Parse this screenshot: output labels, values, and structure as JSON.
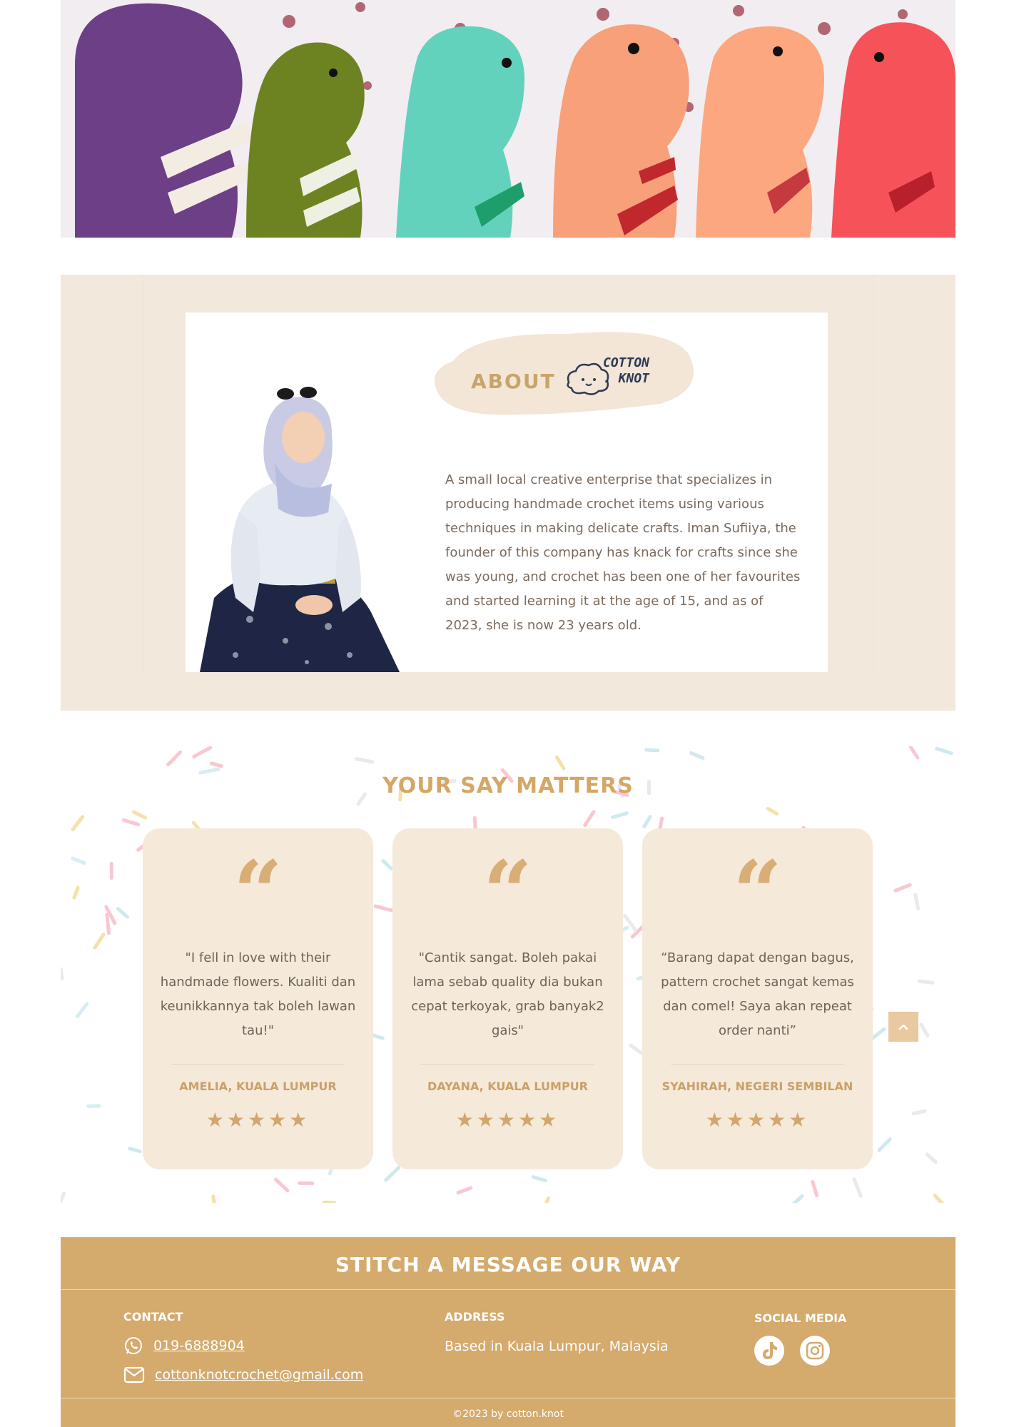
{
  "about": {
    "title": "ABOUT",
    "logo_line1": "COTTON",
    "logo_line2": ". KNOT",
    "paragraph": "A small local creative enterprise that specializes in producing handmade crochet items using various techniques in making delicate crafts. Iman Sufiiya, the founder of this company has knack for crafts since she was young, and crochet has been one of her favourites and started learning it at the age of 15, and as of 2023, she is now 23 years old."
  },
  "testimonials": {
    "title": "YOUR SAY MATTERS",
    "quote_mark": "“",
    "items": [
      {
        "quote": "\"I fell in love with their handmade flowers. Kualiti dan keunikkannya tak boleh lawan tau!\"",
        "author": "AMELIA, KUALA LUMPUR",
        "stars": "★★★★★"
      },
      {
        "quote": "\"Cantik sangat. Boleh pakai lama sebab quality dia bukan cepat terkoyak, grab banyak2 gais\"",
        "author": "DAYANA, KUALA LUMPUR",
        "stars": "★★★★★"
      },
      {
        "quote": "“Barang dapat dengan bagus, pattern crochet sangat kemas dan comel! Saya akan repeat order nanti”",
        "author": "SYAHIRAH, NEGERI SEMBILAN",
        "stars": "★★★★★"
      }
    ],
    "scroll_top_icon": "chevron-up-icon"
  },
  "footer": {
    "title": "STITCH A MESSAGE OUR WAY",
    "contact_heading": "CONTACT",
    "phone": "019-6888904",
    "email": "cottonknotcrochet@gmail.com",
    "address_heading": "ADDRESS",
    "address": "Based in Kuala Lumpur, Malaysia",
    "social_heading": "SOCIAL MEDIA",
    "social_icons": [
      "tiktok-icon",
      "instagram-icon"
    ],
    "copyright": "©2023 by cotton.knot"
  },
  "colors": {
    "accent": "#d4aa6d",
    "about_bg": "#f3e8dc",
    "card_bg": "#f5e9da"
  }
}
